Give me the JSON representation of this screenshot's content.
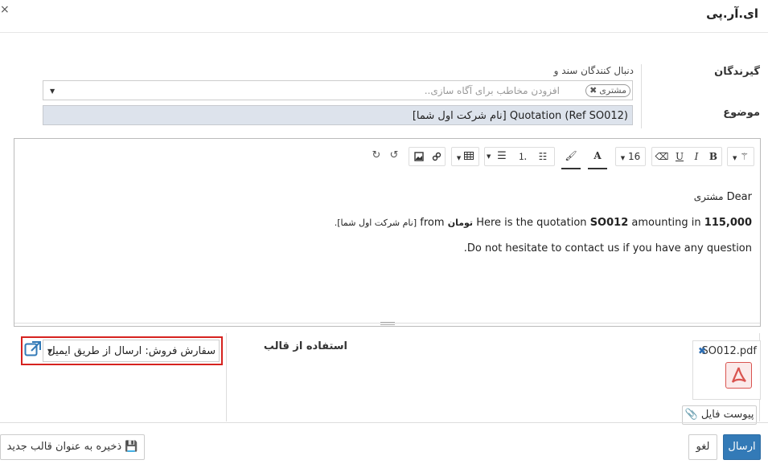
{
  "dialog": {
    "title": "ای.آر.پی",
    "close_glyph": "×"
  },
  "recipients": {
    "label": "گیرندگان",
    "followers_label": "دنبال کنندگان سند و",
    "tags": [
      {
        "label": "مشتری"
      }
    ],
    "placeholder": "افزودن مخاطب برای آگاه سازی.."
  },
  "subject": {
    "label": "موضوع",
    "value": "[نام شرکت اول شما] Quotation (Ref SO012)"
  },
  "toolbar": {
    "font_size": "16",
    "bold": "B",
    "italic": "I",
    "underline": "U",
    "font_color": "A"
  },
  "body": {
    "greeting_prefix": "Dear",
    "greeting_name": "مشتری",
    "line2_before": "Here is the quotation",
    "line2_order": "SO012",
    "line2_middle": "amounting in",
    "line2_amount": "115,000",
    "line2_currency": "تومان",
    "line2_from": "from",
    "line2_company": "[نام شرکت اول شما].",
    "line3": "Do not hesitate to contact us if you have any question."
  },
  "template": {
    "label": "استفاده از قالب",
    "selected": "سفارش فروش: ارسال از طریق ایمیل"
  },
  "attachment": {
    "filename": "SO012.pdf",
    "add_label": "پیوست فایل"
  },
  "footer": {
    "send_label": "ارسال",
    "cancel_label": "لغو",
    "save_template_label": "ذخیره به عنوان قالب جدید"
  },
  "colors": {
    "primary": "#337ab7",
    "highlight_border": "#d6221f",
    "subject_bg": "#dde3ec",
    "pdf_red": "#d9534f"
  }
}
